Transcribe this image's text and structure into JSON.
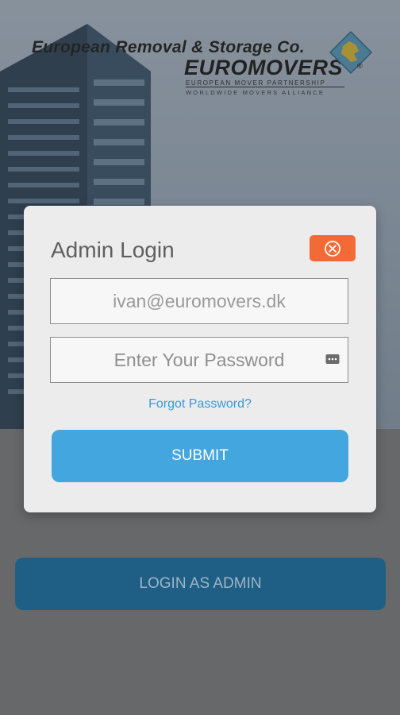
{
  "brand": {
    "company_name": "European Removal & Storage Co.",
    "logo_text": "EUROMOVERS",
    "tagline": "EUROPEAN MOVER PARTNERSHIP",
    "subtagline": "WORLDWIDE MOVERS ALLIANCE",
    "registered_mark": "®"
  },
  "dialog": {
    "title": "Admin Login",
    "close_icon": "close-circle-icon",
    "email_value": "ivan@euromovers.dk",
    "password_placeholder": "Enter Your Password",
    "password_icon": "password-dots-icon",
    "forgot_label": "Forgot Password?",
    "submit_label": "SUBMIT"
  },
  "page": {
    "login_admin_label": "LOGIN AS ADMIN"
  },
  "colors": {
    "accent_blue": "#43a6df",
    "close_orange": "#f26b36",
    "admin_button": "#1f5f86",
    "link_blue": "#3a98d6"
  }
}
